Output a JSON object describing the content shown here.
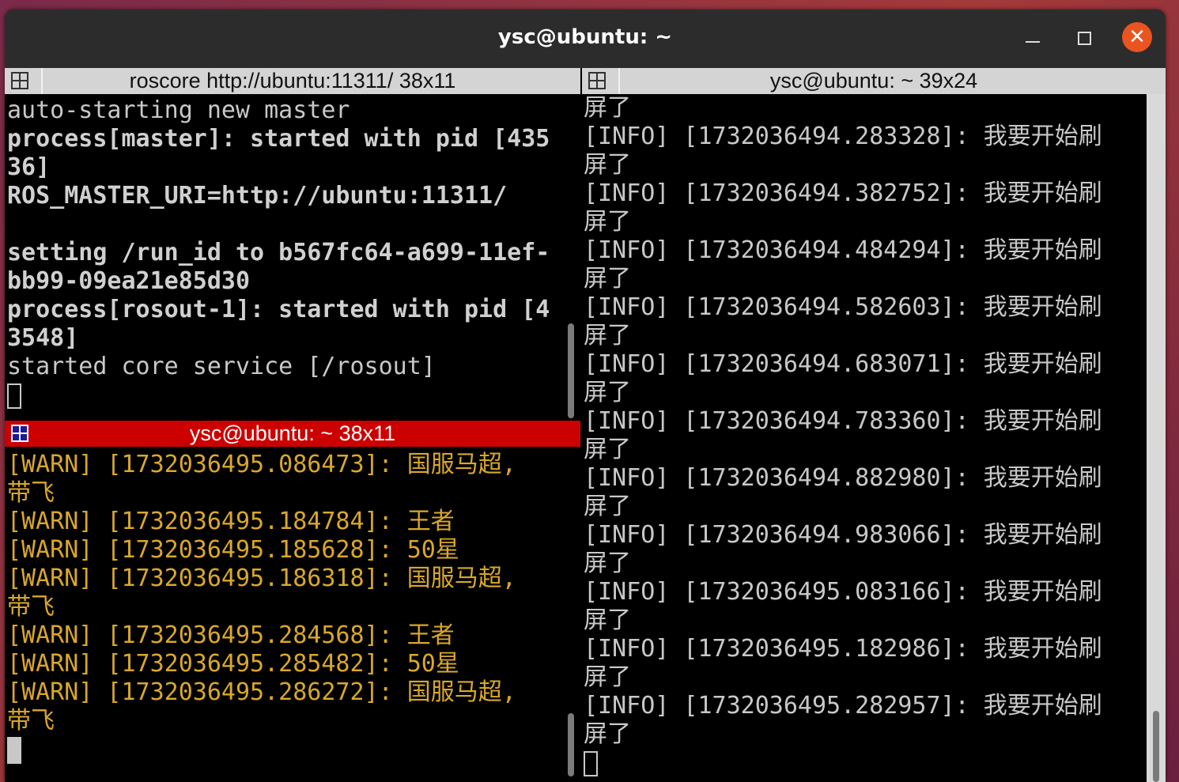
{
  "window": {
    "title": "ysc@ubuntu: ~",
    "close_glyph": "✕"
  },
  "pane_roscore": {
    "header": "roscore http://ubuntu:11311/ 38x11",
    "lines": [
      {
        "text": "auto-starting new master",
        "style": "normal"
      },
      {
        "text": "process[master]: started with pid [435",
        "style": "bold"
      },
      {
        "text": "36]",
        "style": "bold"
      },
      {
        "text": "ROS_MASTER_URI=http://ubuntu:11311/",
        "style": "bold"
      },
      {
        "text": "",
        "style": "bold"
      },
      {
        "text": "setting /run_id to b567fc64-a699-11ef-",
        "style": "bold"
      },
      {
        "text": "bb99-09ea21e85d30",
        "style": "bold"
      },
      {
        "text": "process[rosout-1]: started with pid [4",
        "style": "bold"
      },
      {
        "text": "3548]",
        "style": "bold"
      },
      {
        "text": "started core service [/rosout]",
        "style": "normal"
      }
    ]
  },
  "pane_warn": {
    "header": "ysc@ubuntu: ~ 38x11",
    "lines": [
      "[WARN] [1732036495.086473]: 国服马超,",
      "带飞",
      "[WARN] [1732036495.184784]: 王者",
      "[WARN] [1732036495.185628]: 50星",
      "[WARN] [1732036495.186318]: 国服马超,",
      "带飞",
      "[WARN] [1732036495.284568]: 王者",
      "[WARN] [1732036495.285482]: 50星",
      "[WARN] [1732036495.286272]: 国服马超,",
      "带飞"
    ]
  },
  "pane_info": {
    "header": "ysc@ubuntu: ~ 39x24",
    "lines": [
      "屏了",
      "[INFO] [1732036494.283328]: 我要开始刷",
      "屏了",
      "[INFO] [1732036494.382752]: 我要开始刷",
      "屏了",
      "[INFO] [1732036494.484294]: 我要开始刷",
      "屏了",
      "[INFO] [1732036494.582603]: 我要开始刷",
      "屏了",
      "[INFO] [1732036494.683071]: 我要开始刷",
      "屏了",
      "[INFO] [1732036494.783360]: 我要开始刷",
      "屏了",
      "[INFO] [1732036494.882980]: 我要开始刷",
      "屏了",
      "[INFO] [1732036494.983066]: 我要开始刷",
      "屏了",
      "[INFO] [1732036495.083166]: 我要开始刷",
      "屏了",
      "[INFO] [1732036495.182986]: 我要开始刷",
      "屏了",
      "[INFO] [1732036495.282957]: 我要开始刷",
      "屏了"
    ]
  },
  "colors": {
    "active_header": "#cc0000",
    "warn_text": "#d9a72b",
    "terminal_text": "#c8c8c8",
    "close_button": "#e9541f"
  }
}
